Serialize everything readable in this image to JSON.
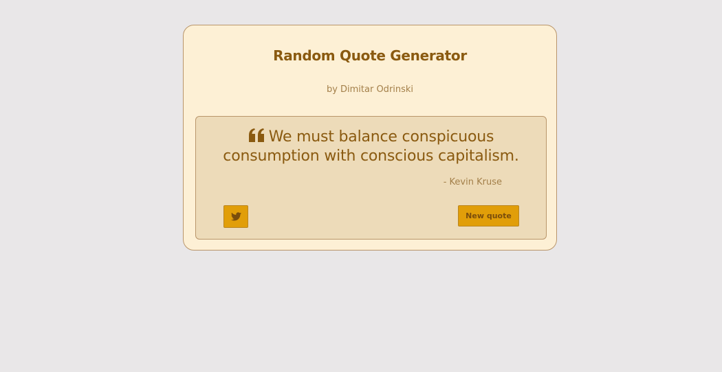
{
  "app": {
    "title": "Random Quote Generator",
    "byline": "by Dimitar Odrinski"
  },
  "quote": {
    "text": "We must balance conspicuous consumption with conscious capitalism.",
    "author": "- Kevin Kruse",
    "icon": "quote-left-icon"
  },
  "actions": {
    "tweet_icon": "twitter-icon",
    "new_quote_label": "New quote"
  },
  "colors": {
    "background": "#e9e7e8",
    "card": "#fdf0d5",
    "quote_box": "#eddbb9",
    "accent": "#e19e09",
    "text": "#8a5a10",
    "muted_text": "#a37f49",
    "border": "#b9956a"
  }
}
